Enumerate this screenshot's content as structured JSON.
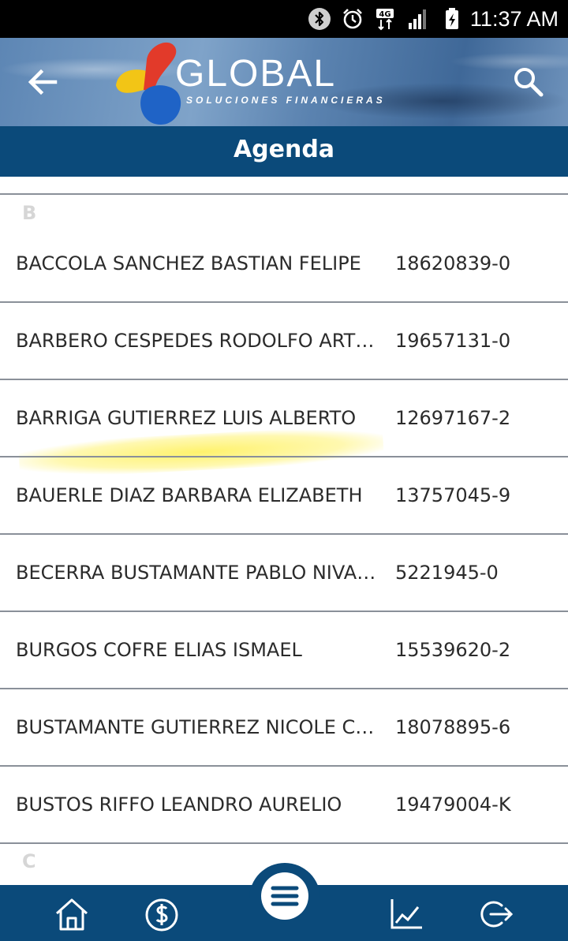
{
  "status_bar": {
    "time": "11:37 AM",
    "network_label": "4G",
    "icons": [
      "bluetooth-icon",
      "alarm-icon",
      "network-4g-icon",
      "signal-icon",
      "battery-charging-icon"
    ]
  },
  "header": {
    "logo_text": "GLOBAL",
    "logo_subtext": "SOLUCIONES FINANCIERAS",
    "back_icon": "arrow-left-icon",
    "search_icon": "search-icon"
  },
  "title": "Agenda",
  "list": {
    "sections": [
      {
        "letter": "B",
        "contacts": [
          {
            "name": "BACCOLA SANCHEZ BASTIAN FELIPE",
            "rut": "18620839-0"
          },
          {
            "name": "BARBERO CESPEDES RODOLFO ARTU...",
            "rut": "19657131-0"
          },
          {
            "name": "BARRIGA GUTIERREZ LUIS ALBERTO",
            "rut": "12697167-2"
          },
          {
            "name": "BAUERLE DIAZ BARBARA ELIZABETH",
            "rut": "13757045-9"
          },
          {
            "name": "BECERRA BUSTAMANTE PABLO NIVAL...",
            "rut": "5221945-0"
          },
          {
            "name": "BURGOS COFRE ELIAS ISMAEL",
            "rut": "15539620-2"
          },
          {
            "name": "BUSTAMANTE GUTIERREZ NICOLE CO...",
            "rut": "18078895-6"
          },
          {
            "name": "BUSTOS RIFFO LEANDRO AURELIO",
            "rut": "19479004-K"
          }
        ]
      },
      {
        "letter": "C",
        "contacts": []
      }
    ]
  },
  "bottom_nav": {
    "items": [
      "home-icon",
      "dollar-icon",
      "menu-icon",
      "chart-icon",
      "logout-icon"
    ]
  },
  "colors": {
    "primary": "#0b4a7a",
    "divider": "#8a9099",
    "section_letter": "#d6d6d6",
    "text": "#2b2b2b"
  }
}
